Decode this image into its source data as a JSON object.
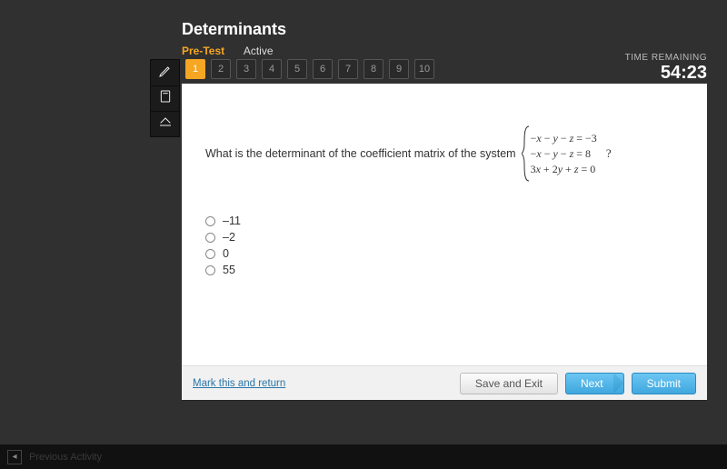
{
  "header": {
    "title": "Determinants",
    "tab_active": "Pre-Test",
    "tab_other": "Active"
  },
  "timer": {
    "label": "TIME REMAINING",
    "value": "54:23"
  },
  "toolbox": {
    "pencil": "pencil-icon",
    "calculator": "calculator-icon",
    "collapse": "collapse-icon"
  },
  "question_nav": {
    "items": [
      "1",
      "2",
      "3",
      "4",
      "5",
      "6",
      "7",
      "8",
      "9",
      "10"
    ],
    "active_index": 0
  },
  "question": {
    "prompt": "What is the determinant of the coefficient matrix of the system",
    "system": {
      "eq1": "−x − y − z = −3",
      "eq2": "−x − y − z = 8",
      "eq3": "3x + 2y + z = 0"
    },
    "post": "?"
  },
  "options": [
    {
      "label": "–11"
    },
    {
      "label": "–2"
    },
    {
      "label": "0"
    },
    {
      "label": "55"
    }
  ],
  "footer": {
    "mark": "Mark this and return",
    "save": "Save and Exit",
    "next": "Next",
    "submit": "Submit"
  },
  "prevbar": {
    "label": "Previous Activity"
  }
}
